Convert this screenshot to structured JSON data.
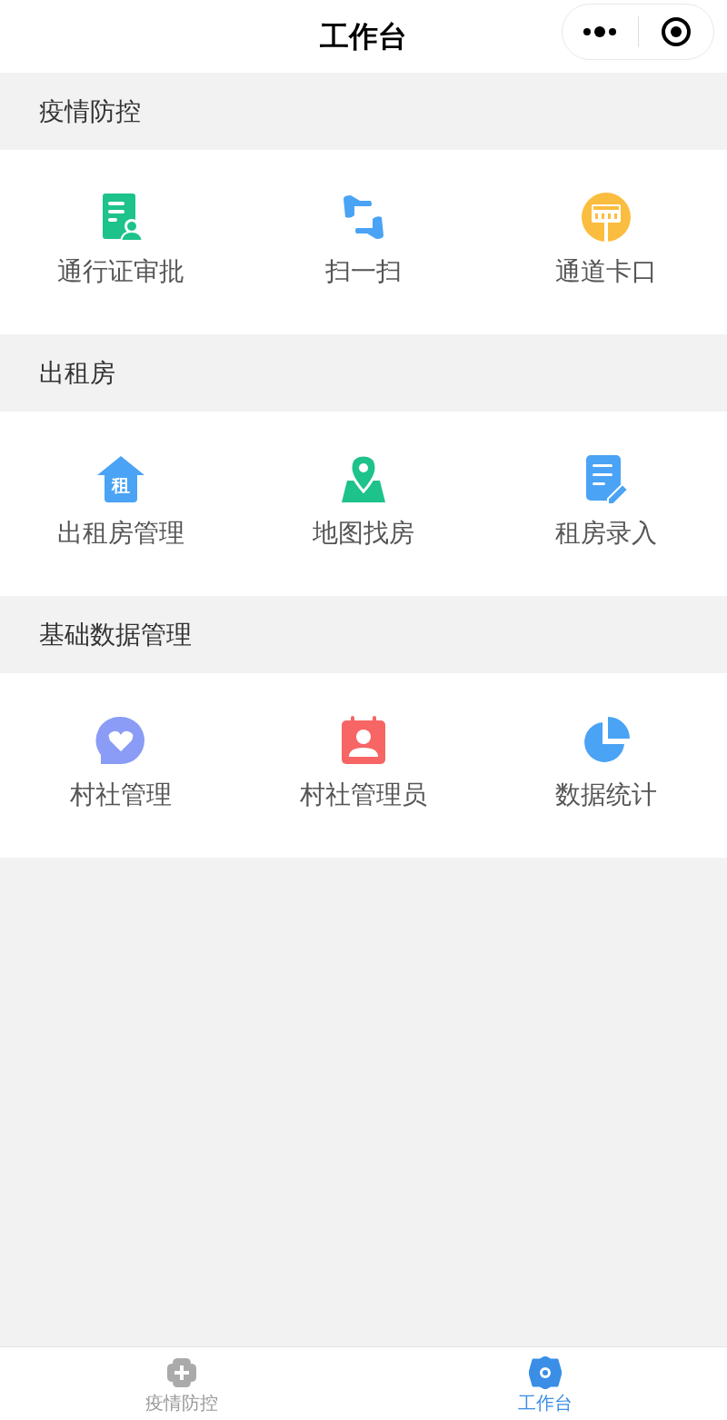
{
  "title": "工作台",
  "sections": [
    {
      "title": "疫情防控",
      "items": [
        {
          "label": "通行证审批",
          "kind": "pass"
        },
        {
          "label": "扫一扫",
          "kind": "scan"
        },
        {
          "label": "通道卡口",
          "kind": "gate"
        }
      ]
    },
    {
      "title": "出租房",
      "items": [
        {
          "label": "出租房管理",
          "kind": "house",
          "icon_text": "租"
        },
        {
          "label": "地图找房",
          "kind": "map"
        },
        {
          "label": "租房录入",
          "kind": "edit"
        }
      ]
    },
    {
      "title": "基础数据管理",
      "items": [
        {
          "label": "村社管理",
          "kind": "chat"
        },
        {
          "label": "村社管理员",
          "kind": "contact"
        },
        {
          "label": "数据统计",
          "kind": "pie"
        }
      ]
    }
  ],
  "tabs": [
    {
      "label": "疫情防控",
      "kind": "cross",
      "selected": false
    },
    {
      "label": "工作台",
      "kind": "gear",
      "selected": true
    }
  ]
}
